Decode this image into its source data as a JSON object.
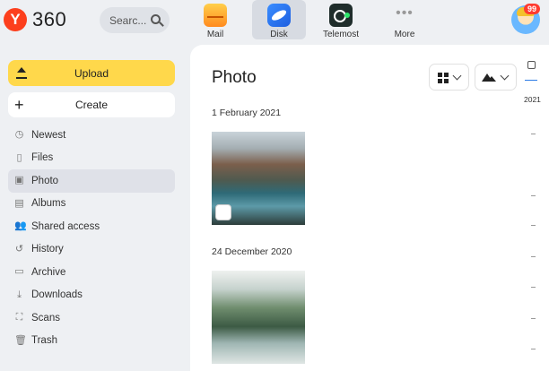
{
  "header": {
    "logo_letter": "Y",
    "logo_text": "360",
    "search_placeholder": "Searc...",
    "apps": [
      {
        "label": "Mail",
        "icon": "mail-icon"
      },
      {
        "label": "Disk",
        "icon": "disk-icon",
        "active": true
      },
      {
        "label": "Telemost",
        "icon": "telemost-icon"
      },
      {
        "label": "More",
        "icon": "more-icon"
      }
    ],
    "notification_count": "99"
  },
  "sidebar": {
    "upload_label": "Upload",
    "create_label": "Create",
    "items": [
      {
        "label": "Newest",
        "icon": "clock-icon"
      },
      {
        "label": "Files",
        "icon": "file-icon"
      },
      {
        "label": "Photo",
        "icon": "photo-icon",
        "active": true
      },
      {
        "label": "Albums",
        "icon": "albums-icon"
      },
      {
        "label": "Shared access",
        "icon": "people-icon"
      },
      {
        "label": "History",
        "icon": "history-icon"
      },
      {
        "label": "Archive",
        "icon": "archive-icon"
      },
      {
        "label": "Downloads",
        "icon": "download-icon"
      },
      {
        "label": "Scans",
        "icon": "scan-icon"
      },
      {
        "label": "Trash",
        "icon": "trash-icon"
      }
    ]
  },
  "main": {
    "title": "Photo",
    "groups": [
      {
        "date": "1 February 2021"
      },
      {
        "date": "24 December 2020"
      }
    ],
    "timeline_year": "2021"
  },
  "colors": {
    "accent_yellow": "#ffd84b",
    "logo_red": "#fc3f1d",
    "timeline_blue": "#2c7be5"
  }
}
